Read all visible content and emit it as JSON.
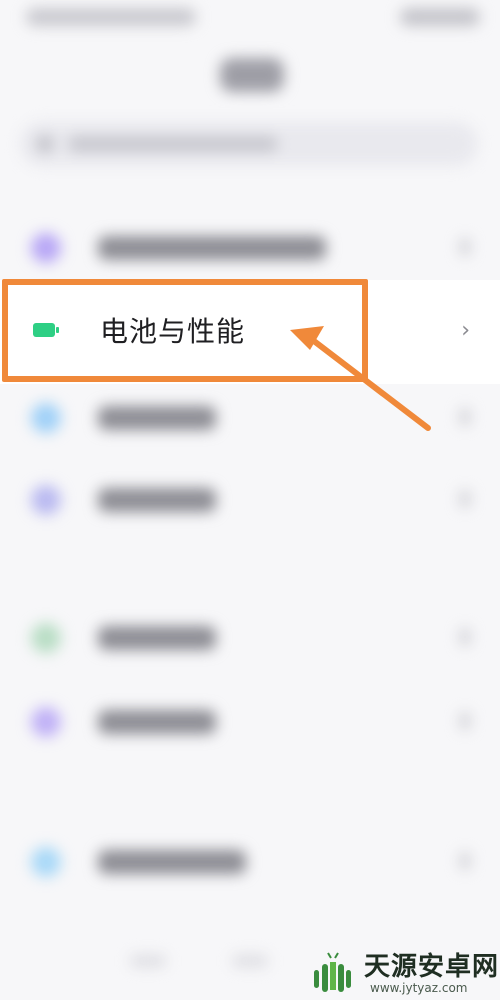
{
  "settings": {
    "focused_item": {
      "label": "电池与性能",
      "icon": "battery-icon",
      "chevron": "›"
    },
    "blurred_rows": [
      {
        "icon_color": "#b7a6f5"
      },
      {
        "icon_color": "#9fd0f7"
      },
      {
        "icon_color": "#b9b9f0"
      },
      {
        "icon_color": "#b8ddc4"
      },
      {
        "icon_color": "#bfb0f6"
      },
      {
        "icon_color": "#a8d8f7"
      }
    ]
  },
  "annotation": {
    "highlight_color": "#f0893a"
  },
  "watermark": {
    "title": "天源安卓网",
    "url": "www.jytyaz.com"
  }
}
